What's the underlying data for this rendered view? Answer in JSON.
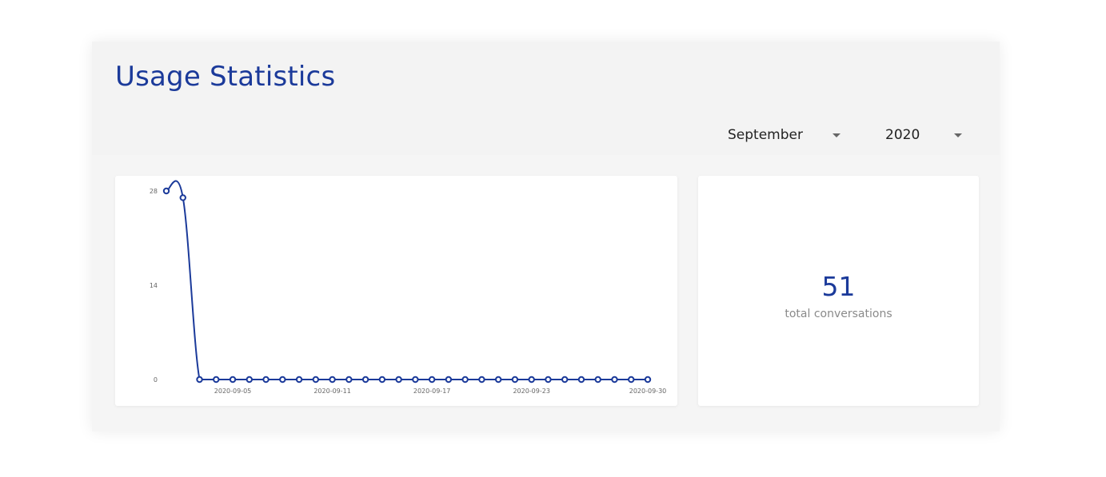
{
  "header": {
    "title": "Usage Statistics"
  },
  "filters": {
    "month": "September",
    "year": "2020"
  },
  "summary": {
    "value": "51",
    "label": "total conversations"
  },
  "colors": {
    "accent": "#1b3a9a",
    "panel": "#f3f3f3",
    "muted": "#8a8a8a"
  },
  "icons": {
    "dropdown": "caret-down-icon"
  },
  "chart_data": {
    "type": "line",
    "x": [
      "2020-09-01",
      "2020-09-02",
      "2020-09-03",
      "2020-09-04",
      "2020-09-05",
      "2020-09-06",
      "2020-09-07",
      "2020-09-08",
      "2020-09-09",
      "2020-09-10",
      "2020-09-11",
      "2020-09-12",
      "2020-09-13",
      "2020-09-14",
      "2020-09-15",
      "2020-09-16",
      "2020-09-17",
      "2020-09-18",
      "2020-09-19",
      "2020-09-20",
      "2020-09-21",
      "2020-09-22",
      "2020-09-23",
      "2020-09-24",
      "2020-09-25",
      "2020-09-26",
      "2020-09-27",
      "2020-09-28",
      "2020-09-29",
      "2020-09-30"
    ],
    "series": [
      {
        "values": [
          28,
          27,
          0,
          0,
          0,
          0,
          0,
          0,
          0,
          0,
          0,
          0,
          0,
          0,
          0,
          0,
          0,
          0,
          0,
          0,
          0,
          0,
          0,
          0,
          0,
          0,
          0,
          0,
          0,
          0
        ]
      }
    ],
    "ylim": [
      0,
      28
    ],
    "yticks": [
      "0",
      "14",
      "28"
    ],
    "xticks": [
      "2020-09-05",
      "2020-09-11",
      "2020-09-17",
      "2020-09-23",
      "2020-09-30"
    ],
    "grid": false,
    "title": "",
    "xlabel": "",
    "ylabel": ""
  }
}
